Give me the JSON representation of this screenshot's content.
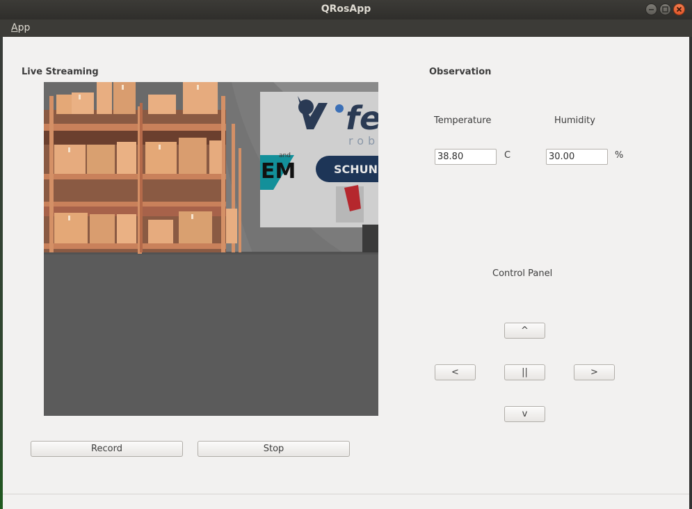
{
  "window": {
    "title": "QRosApp"
  },
  "menubar": {
    "app_mnemonic": "A",
    "app_rest": "pp"
  },
  "stream": {
    "title": "Live Streaming"
  },
  "observation": {
    "title": "Observation",
    "temperature_label": "Temperature",
    "humidity_label": "Humidity",
    "temperature_value": "38.80",
    "temperature_unit": "C",
    "humidity_value": "30.00",
    "humidity_unit": "%"
  },
  "control": {
    "title": "Control Panel",
    "up_label": "^",
    "left_label": "<",
    "stop_label": "||",
    "right_label": ">",
    "down_label": "v"
  },
  "recording": {
    "record_label": "Record",
    "stop_label": "Stop"
  },
  "scene": {
    "sign_brand": "fe",
    "sign_brand_sub": "rob",
    "sign_em": "EM",
    "sign_schunk": "SCHUN",
    "sign_small": "and"
  }
}
